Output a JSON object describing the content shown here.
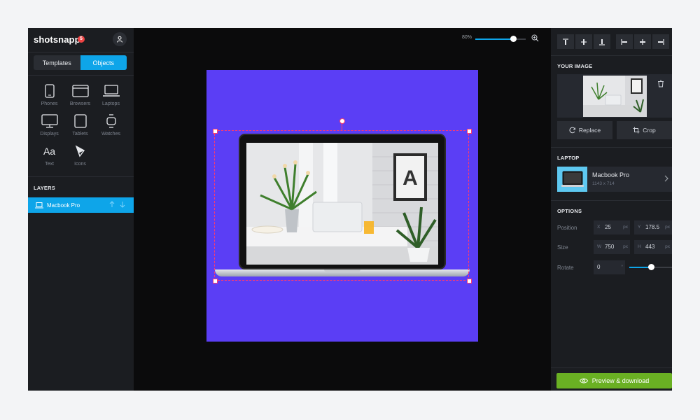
{
  "brand": {
    "name": "shotsnapp",
    "badge": "5"
  },
  "tabs": {
    "templates": "Templates",
    "objects": "Objects"
  },
  "objects": [
    {
      "label": "Phones",
      "icon": "phone-icon"
    },
    {
      "label": "Browsers",
      "icon": "browser-icon"
    },
    {
      "label": "Laptops",
      "icon": "laptop-icon"
    },
    {
      "label": "Displays",
      "icon": "display-icon"
    },
    {
      "label": "Tablets",
      "icon": "tablet-icon"
    },
    {
      "label": "Watches",
      "icon": "watch-icon"
    },
    {
      "label": "Text",
      "icon": "text-icon"
    },
    {
      "label": "Icons",
      "icon": "icons-icon"
    }
  ],
  "text_icon_glyph": "Aa",
  "layers": {
    "title": "LAYERS",
    "items": [
      {
        "label": "Macbook Pro"
      }
    ]
  },
  "zoom": {
    "label": "80%",
    "value": 0.75
  },
  "canvas": {
    "background": "#5b3ef5",
    "screen_letter": "A"
  },
  "right_panel": {
    "your_image": {
      "title": "YOUR IMAGE",
      "replace": "Replace",
      "crop": "Crop"
    },
    "laptop": {
      "title": "LAPTOP",
      "name": "Macbook Pro",
      "dimensions": "1143 x 714"
    },
    "options": {
      "title": "OPTIONS",
      "position": {
        "label": "Position",
        "x": "25",
        "y": "178.5",
        "x_prefix": "X",
        "y_prefix": "Y",
        "unit": "px"
      },
      "size": {
        "label": "Size",
        "w": "750",
        "h": "443",
        "w_prefix": "W",
        "h_prefix": "H",
        "unit": "px"
      },
      "rotate": {
        "label": "Rotate",
        "value": "0",
        "unit": "°",
        "slider": 0.5
      }
    },
    "download": "Preview & download"
  },
  "colors": {
    "accent": "#0ea5e9",
    "download": "#6ab023",
    "selection": "#ff3b6b"
  }
}
